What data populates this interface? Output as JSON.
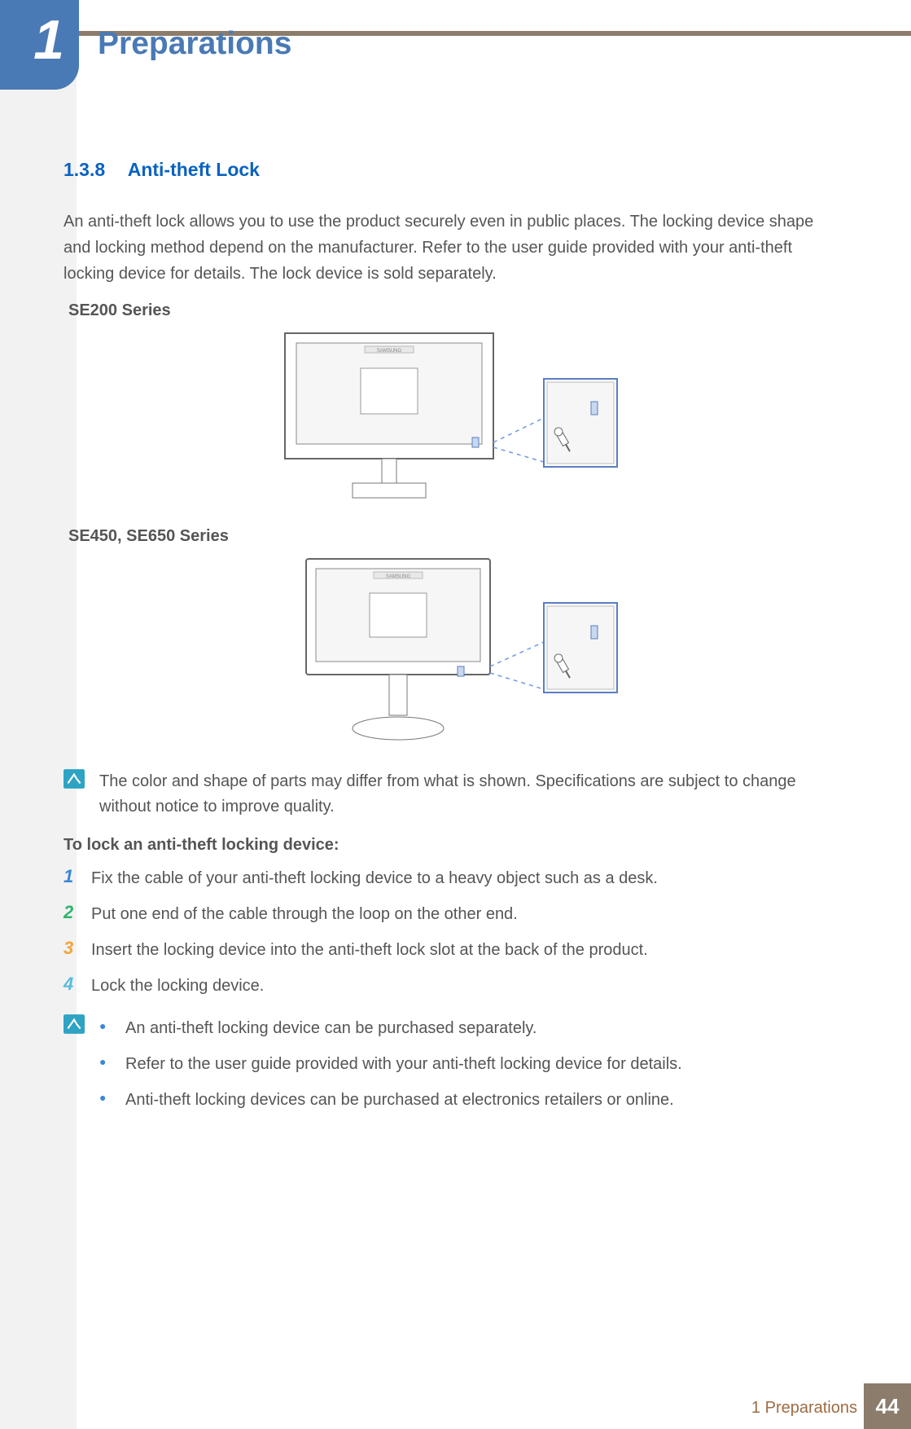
{
  "chapter": {
    "number": "1",
    "title": "Preparations"
  },
  "section": {
    "number": "1.3.8",
    "title": "Anti-theft Lock"
  },
  "intro": "An anti-theft lock allows you to use the product securely even in public places. The locking device shape and locking method depend on the manufacturer. Refer to the user guide provided with your anti-theft locking device for details. The lock device is sold separately.",
  "series1_label": "SE200 Series",
  "series2_label": "SE450, SE650 Series",
  "note1": "The color and shape of parts may differ from what is shown. Specifications are subject to change without notice to improve quality.",
  "instructions_heading": "To lock an anti-theft locking device:",
  "steps": [
    "Fix the cable of your anti-theft locking device to a heavy object such as a desk.",
    "Put one end of the cable through the loop on the other end.",
    "Insert the locking device into the anti-theft lock slot at the back of the product.",
    "Lock the locking device."
  ],
  "note2_bullets": [
    "An anti-theft locking device can be purchased separately.",
    "Refer to the user guide provided with your anti-theft locking device for details.",
    "Anti-theft locking devices can be purchased at electronics retailers or online."
  ],
  "figure_brand": "SAMSUNG",
  "footer": {
    "label": "1 Preparations",
    "page": "44"
  }
}
